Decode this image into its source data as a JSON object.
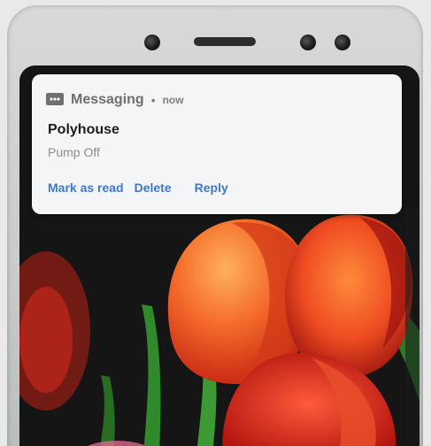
{
  "notification": {
    "app_name": "Messaging",
    "separator": "•",
    "time": "now",
    "title": "Polyhouse",
    "message": "Pump Off",
    "actions": [
      {
        "label": "Mark as read"
      },
      {
        "label": "Delete"
      },
      {
        "label": "Reply"
      }
    ],
    "accent_color": "#3f78c8",
    "icon": "messaging-icon"
  },
  "wallpaper": {
    "subject": "tulips-photo",
    "colors": [
      "#e0301d",
      "#f3742a",
      "#1a1a1a",
      "#2f8a2c"
    ]
  }
}
